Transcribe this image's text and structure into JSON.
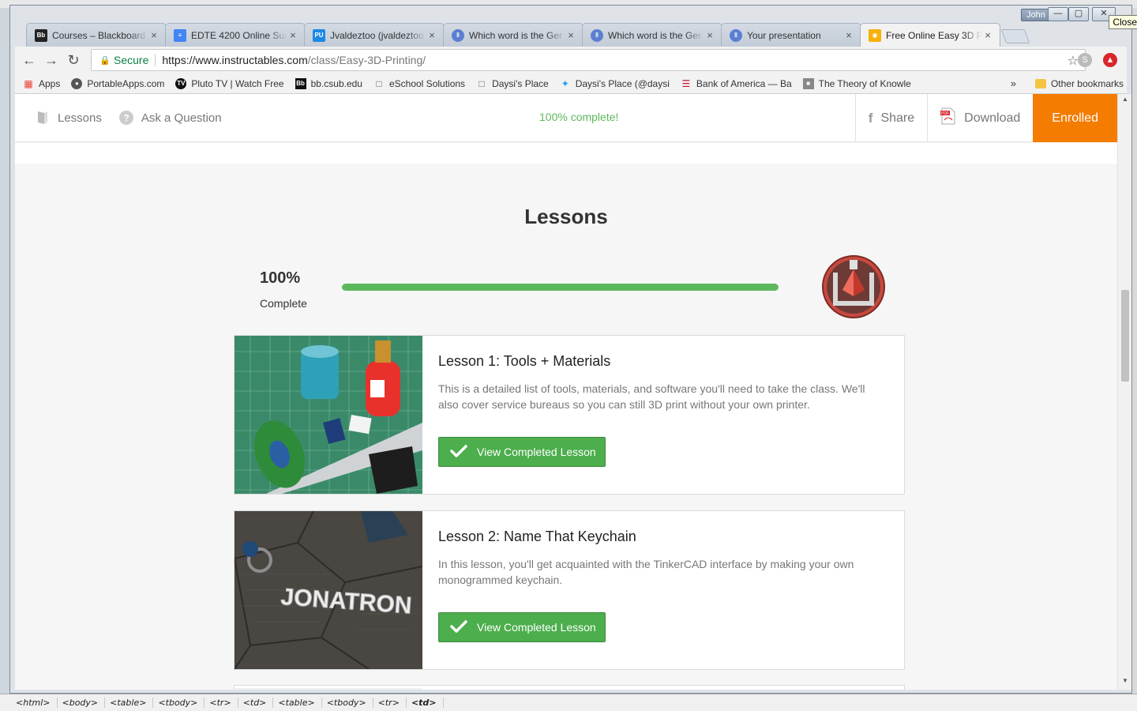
{
  "window": {
    "user": "John",
    "close_tooltip": "Close"
  },
  "tabs": [
    {
      "title": "Courses – Blackboard",
      "icon": "Bb",
      "active": false
    },
    {
      "title": "EDTE 4200 Online Sum",
      "icon": "doc",
      "active": false
    },
    {
      "title": "Jvaldeztoo (jvaldeztoo",
      "icon": "PU",
      "active": false
    },
    {
      "title": "Which word is the Ger",
      "icon": "menti",
      "active": false
    },
    {
      "title": "Which word is the Ger",
      "icon": "menti",
      "active": false
    },
    {
      "title": "Your presentation",
      "icon": "menti",
      "active": false
    },
    {
      "title": "Free Online Easy 3D P",
      "icon": "robot",
      "active": true
    }
  ],
  "toolbar": {
    "secure_label": "Secure",
    "url_host": "https://www.instructables.com",
    "url_path": "/class/Easy-3D-Printing/"
  },
  "bookmarks": {
    "items": [
      {
        "label": "Apps"
      },
      {
        "label": "PortableApps.com"
      },
      {
        "label": "Pluto TV | Watch Free"
      },
      {
        "label": "bb.csub.edu"
      },
      {
        "label": "eSchool Solutions"
      },
      {
        "label": "Daysi's Place"
      },
      {
        "label": "Daysi's Place (@daysi"
      },
      {
        "label": "Bank of America — Ba"
      },
      {
        "label": "The Theory of Knowle"
      }
    ],
    "more": "»",
    "other": "Other bookmarks"
  },
  "class_nav": {
    "lessons": "Lessons",
    "ask": "Ask a Question",
    "progress_text": "100% complete!",
    "share": "Share",
    "download": "Download",
    "enrolled": "Enrolled"
  },
  "lessons": {
    "title": "Lessons",
    "percent_label": "100%",
    "complete_label": "Complete",
    "progress_fraction": 1.0,
    "items": [
      {
        "title": "Lesson 1: Tools + Materials",
        "description": "This is a detailed list of tools, materials, and software you'll need to take the class. We'll also cover service bureaus so you can still 3D print without your own printer.",
        "button": "View Completed Lesson"
      },
      {
        "title": "Lesson 2: Name That Keychain",
        "description": "In this lesson, you'll get acquainted with the TinkerCAD interface by making your own monogrammed keychain.",
        "button": "View Completed Lesson",
        "image_text": "JONATRON"
      }
    ]
  },
  "status_bar": [
    "<html>",
    "<body>",
    "<table>",
    "<tbody>",
    "<tr>",
    "<td>",
    "<table>",
    "<tbody>",
    "<tr>",
    "<td>"
  ],
  "colors": {
    "accent_green": "#5cb85c",
    "enrolled_orange": "#f47c00",
    "secure_green": "#0b8043"
  }
}
